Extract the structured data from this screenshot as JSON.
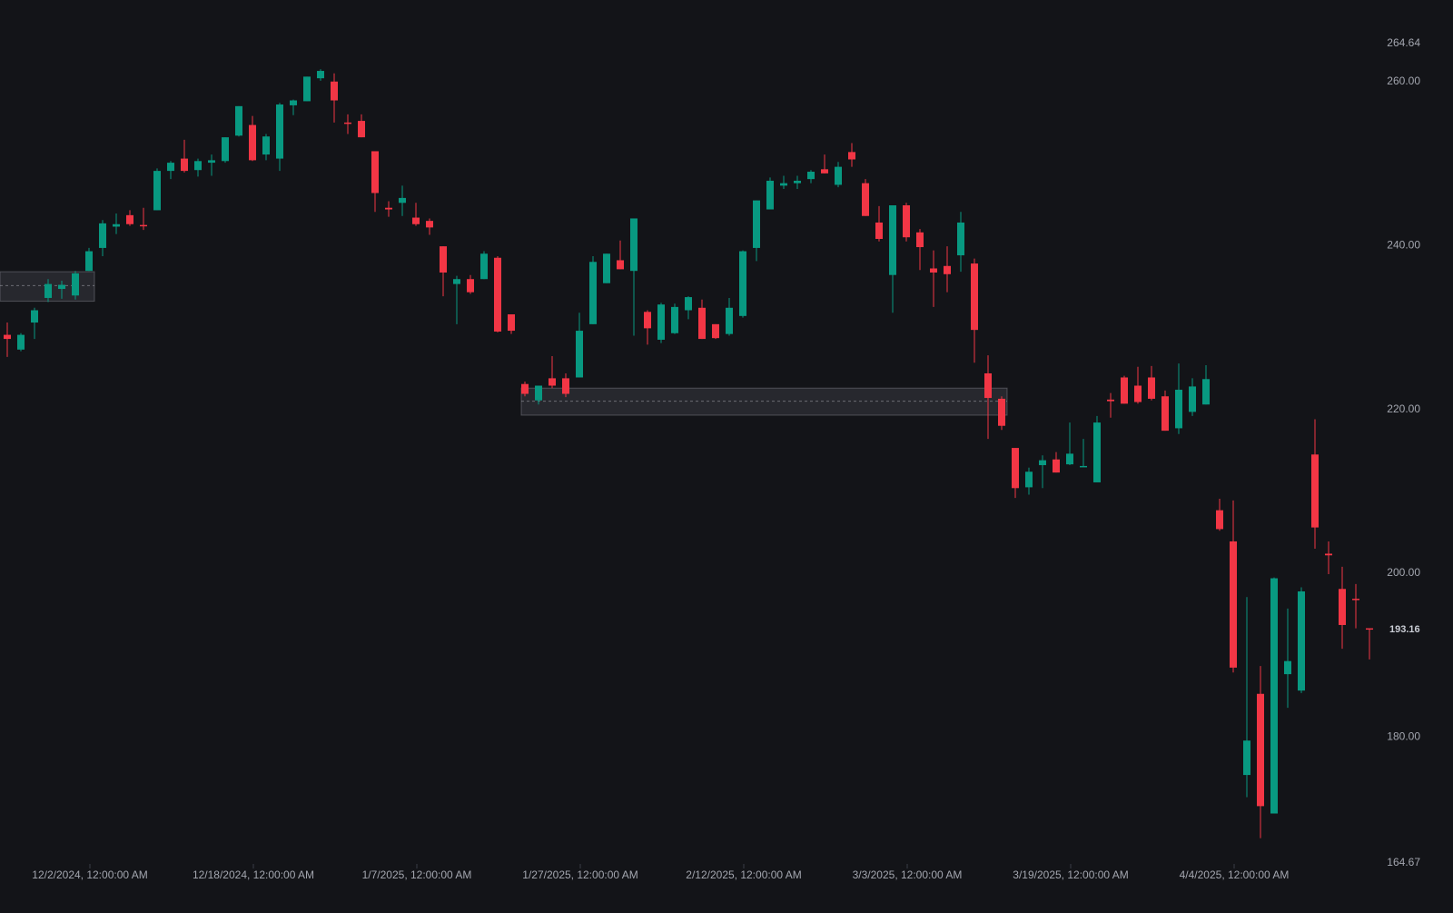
{
  "chart_data": {
    "type": "candlestick",
    "ylim": [
      164.67,
      264.64
    ],
    "y_ticks": [
      "264.64",
      "260.00",
      "240.00",
      "220.00",
      "200.00",
      "180.00",
      "164.67"
    ],
    "x_ticks": [
      "12/2/2024, 12:00:00 AM",
      "12/18/2024, 12:00:00 AM",
      "1/7/2025, 12:00:00 AM",
      "1/27/2025, 12:00:00 AM",
      "2/12/2025, 12:00:00 AM",
      "3/3/2025, 12:00:00 AM",
      "3/19/2025, 12:00:00 AM",
      "4/4/2025, 12:00:00 AM"
    ],
    "x_tick_bar_index": [
      6,
      18,
      30,
      42,
      54,
      66,
      78,
      90
    ],
    "last_price": {
      "value": 193.16,
      "label": "193.16"
    },
    "colors": {
      "up": "#089981",
      "down": "#f23645",
      "background": "#131418",
      "axis_text": "#a3a6af"
    },
    "zones": [
      {
        "start_index": -1,
        "end_index": 6,
        "top": 236.7,
        "bottom": 233.1,
        "mid": 235.0
      },
      {
        "start_index": 38,
        "end_index": 73,
        "top": 222.5,
        "bottom": 219.2,
        "mid": 220.9
      }
    ],
    "candles": [
      [
        229.0,
        230.5,
        226.3,
        228.5
      ],
      [
        227.2,
        229.2,
        227.0,
        229.0
      ],
      [
        230.5,
        232.3,
        228.5,
        232.0
      ],
      [
        233.5,
        235.8,
        233.0,
        235.2
      ],
      [
        234.6,
        235.6,
        233.4,
        235.1
      ],
      [
        233.8,
        236.8,
        233.3,
        236.5
      ],
      [
        236.8,
        239.6,
        236.8,
        239.2
      ],
      [
        239.6,
        243.0,
        238.6,
        242.6
      ],
      [
        242.2,
        243.8,
        241.3,
        242.5
      ],
      [
        243.6,
        244.2,
        242.3,
        242.5
      ],
      [
        242.4,
        244.5,
        241.8,
        242.3
      ],
      [
        244.2,
        249.3,
        244.2,
        249.0
      ],
      [
        249.0,
        250.2,
        248.0,
        250.0
      ],
      [
        250.5,
        252.8,
        248.8,
        249.0
      ],
      [
        249.1,
        250.5,
        248.3,
        250.2
      ],
      [
        250.0,
        251.0,
        248.4,
        250.3
      ],
      [
        250.2,
        253.0,
        250.0,
        253.1
      ],
      [
        253.3,
        256.7,
        253.2,
        256.9
      ],
      [
        254.6,
        255.7,
        250.2,
        250.3
      ],
      [
        251.0,
        253.5,
        250.3,
        253.2
      ],
      [
        250.5,
        257.3,
        249.0,
        257.1
      ],
      [
        257.0,
        257.7,
        255.8,
        257.6
      ],
      [
        257.5,
        260.5,
        257.5,
        260.5
      ],
      [
        260.3,
        261.4,
        260.0,
        261.2
      ],
      [
        259.9,
        260.9,
        254.9,
        257.6
      ],
      [
        254.9,
        255.9,
        253.5,
        254.8
      ],
      [
        255.1,
        255.9,
        253.1,
        253.1
      ],
      [
        251.4,
        251.4,
        244.0,
        246.3
      ],
      [
        244.5,
        245.3,
        243.4,
        244.3
      ],
      [
        245.1,
        247.2,
        243.5,
        245.7
      ],
      [
        243.3,
        245.1,
        242.3,
        242.5
      ],
      [
        242.9,
        243.2,
        241.2,
        242.1
      ],
      [
        239.8,
        239.8,
        233.7,
        236.6
      ],
      [
        235.2,
        236.2,
        230.3,
        235.8
      ],
      [
        235.8,
        236.3,
        234.0,
        234.2
      ],
      [
        235.8,
        239.2,
        235.8,
        238.9
      ],
      [
        238.4,
        238.6,
        229.3,
        229.4
      ],
      [
        231.5,
        231.5,
        229.1,
        229.5
      ],
      [
        223.0,
        223.3,
        221.5,
        221.8
      ],
      [
        221.0,
        222.8,
        220.5,
        222.8
      ],
      [
        223.7,
        226.4,
        222.5,
        222.8
      ],
      [
        223.7,
        224.3,
        221.4,
        221.8
      ],
      [
        223.8,
        231.7,
        223.8,
        229.5
      ],
      [
        230.3,
        238.6,
        230.3,
        237.9
      ],
      [
        235.3,
        238.1,
        235.3,
        238.9
      ],
      [
        238.1,
        240.5,
        237.6,
        237.0
      ],
      [
        236.8,
        237.1,
        228.9,
        243.2
      ],
      [
        231.8,
        232.0,
        227.8,
        229.8
      ],
      [
        228.4,
        232.9,
        228.0,
        232.7
      ],
      [
        229.2,
        232.8,
        229.1,
        232.4
      ],
      [
        232.0,
        233.7,
        230.9,
        233.6
      ],
      [
        232.3,
        233.3,
        228.5,
        228.5
      ],
      [
        230.3,
        230.3,
        228.5,
        228.6
      ],
      [
        229.1,
        233.5,
        228.9,
        232.3
      ],
      [
        231.3,
        239.3,
        231.1,
        239.2
      ],
      [
        239.6,
        244.2,
        238.0,
        245.4
      ],
      [
        244.3,
        248.2,
        244.5,
        247.8
      ],
      [
        247.2,
        248.4,
        246.8,
        247.5
      ],
      [
        247.5,
        248.4,
        246.8,
        247.8
      ],
      [
        248.0,
        249.1,
        247.5,
        248.9
      ],
      [
        249.2,
        251.0,
        248.7,
        248.7
      ],
      [
        247.3,
        250.1,
        247.0,
        249.5
      ],
      [
        251.3,
        252.4,
        249.5,
        250.4
      ],
      [
        247.5,
        248.0,
        243.5,
        243.5
      ],
      [
        242.7,
        244.7,
        240.4,
        240.7
      ],
      [
        236.3,
        236.7,
        231.7,
        244.8
      ],
      [
        244.8,
        245.1,
        240.4,
        240.9
      ],
      [
        241.5,
        241.9,
        236.9,
        239.7
      ],
      [
        237.1,
        239.3,
        232.4,
        236.6
      ],
      [
        237.4,
        239.8,
        234.2,
        236.4
      ],
      [
        238.7,
        244.0,
        236.7,
        242.7
      ],
      [
        237.7,
        238.3,
        225.6,
        229.6
      ],
      [
        224.3,
        226.5,
        216.3,
        221.3
      ],
      [
        221.2,
        221.5,
        217.4,
        217.9
      ],
      [
        215.2,
        214.6,
        209.1,
        210.3
      ],
      [
        210.4,
        212.8,
        209.5,
        212.3
      ],
      [
        213.1,
        214.3,
        210.3,
        213.7
      ],
      [
        213.8,
        214.7,
        212.2,
        212.2
      ],
      [
        213.2,
        218.3,
        213.1,
        214.5
      ],
      [
        212.9,
        216.3,
        213.1,
        213.0
      ],
      [
        211.0,
        219.1,
        211.0,
        218.3
      ],
      [
        221.1,
        221.9,
        218.9,
        220.9
      ],
      [
        223.8,
        224.0,
        220.9,
        220.6
      ],
      [
        222.8,
        225.1,
        220.6,
        220.8
      ],
      [
        223.8,
        225.2,
        221.0,
        221.2
      ],
      [
        221.5,
        222.2,
        217.6,
        217.3
      ],
      [
        217.6,
        225.5,
        216.9,
        222.3
      ],
      [
        219.6,
        223.7,
        219.1,
        222.7
      ],
      [
        220.5,
        225.3,
        222.5,
        223.6
      ],
      [
        207.6,
        209.0,
        205.1,
        205.3
      ],
      [
        203.8,
        208.8,
        187.8,
        188.4
      ],
      [
        175.3,
        197.0,
        172.6,
        179.5
      ],
      [
        185.2,
        188.6,
        167.6,
        171.5
      ],
      [
        170.6,
        199.4,
        170.6,
        199.3
      ],
      [
        187.6,
        195.6,
        183.5,
        189.2
      ],
      [
        185.6,
        198.2,
        185.3,
        197.7
      ],
      [
        214.4,
        218.7,
        202.9,
        205.5
      ],
      [
        202.3,
        203.8,
        199.8,
        202.1
      ],
      [
        198.0,
        200.7,
        190.7,
        193.6
      ],
      [
        196.8,
        198.6,
        193.2,
        196.7
      ],
      [
        193.2,
        193.2,
        189.4,
        193.1
      ]
    ]
  }
}
